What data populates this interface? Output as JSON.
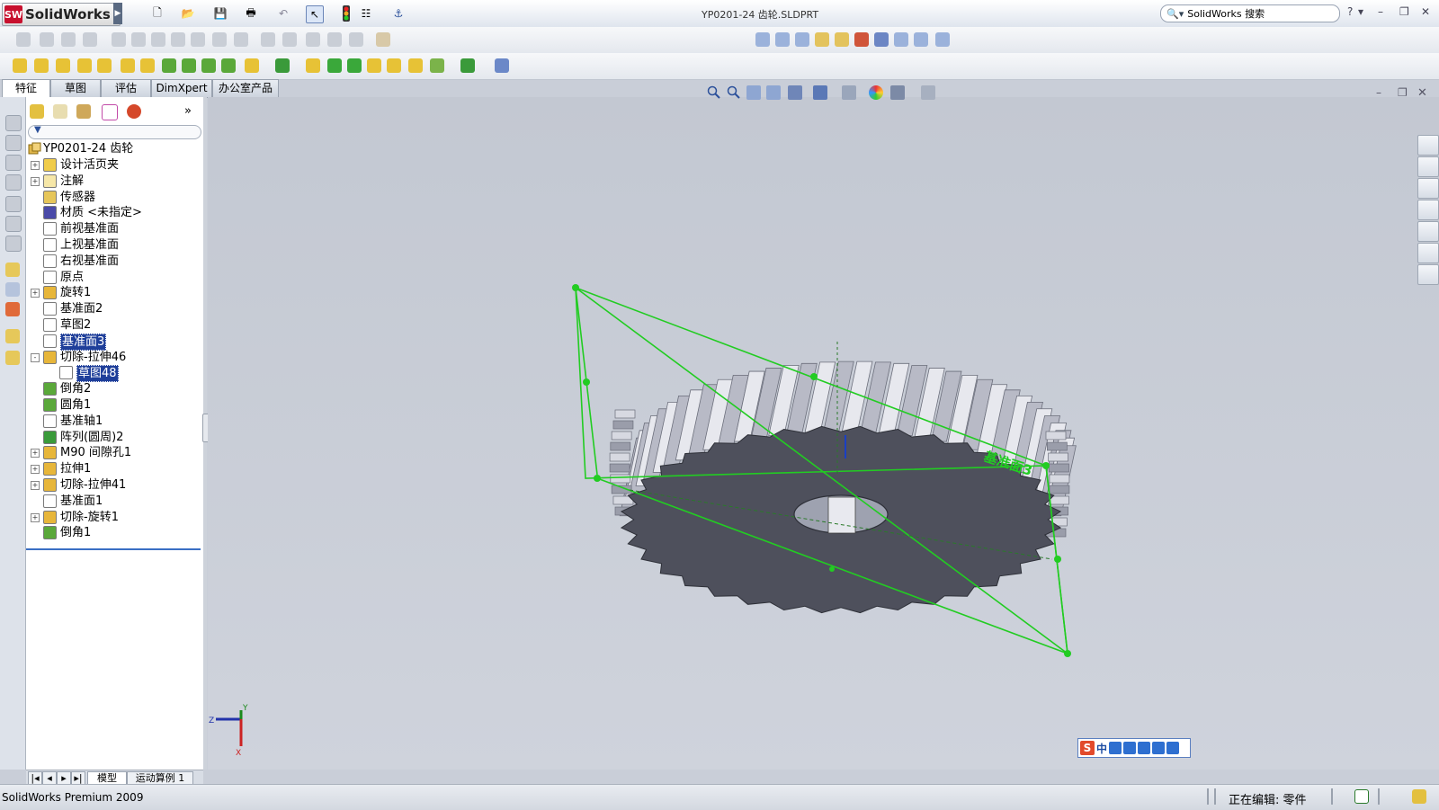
{
  "app": {
    "logo_text": "SolidWorks",
    "document_title": "YP0201-24 齿轮.SLDPRT",
    "search_placeholder": "SolidWorks 搜索",
    "help_label": "?"
  },
  "command_tabs": [
    "特征",
    "草图",
    "评估",
    "DimXpert",
    "办公室产品"
  ],
  "feature_tree": {
    "root": "YP0201-24 齿轮",
    "items": [
      {
        "label": "设计活页夹",
        "expand": "+",
        "icon": "binder-icon"
      },
      {
        "label": "注解",
        "expand": "+",
        "icon": "annotation-icon"
      },
      {
        "label": "传感器",
        "expand": "",
        "icon": "sensor-icon"
      },
      {
        "label": "材质 <未指定>",
        "expand": "",
        "icon": "material-icon"
      },
      {
        "label": "前视基准面",
        "expand": "",
        "icon": "plane-icon"
      },
      {
        "label": "上视基准面",
        "expand": "",
        "icon": "plane-icon"
      },
      {
        "label": "右视基准面",
        "expand": "",
        "icon": "plane-icon"
      },
      {
        "label": "原点",
        "expand": "",
        "icon": "origin-icon"
      },
      {
        "label": "旋转1",
        "expand": "+",
        "icon": "revolve-icon"
      },
      {
        "label": "基准面2",
        "expand": "",
        "icon": "plane-icon"
      },
      {
        "label": "草图2",
        "expand": "",
        "icon": "sketch-icon"
      },
      {
        "label": "基准面3",
        "expand": "",
        "icon": "plane-icon",
        "selected": true
      },
      {
        "label": "切除-拉伸46",
        "expand": "-",
        "icon": "cut-extrude-icon"
      },
      {
        "label": "草图48",
        "expand": "",
        "icon": "sketch-icon",
        "selected": true,
        "child": true
      },
      {
        "label": "倒角2",
        "expand": "",
        "icon": "chamfer-icon"
      },
      {
        "label": "圆角1",
        "expand": "",
        "icon": "fillet-icon"
      },
      {
        "label": "基准轴1",
        "expand": "",
        "icon": "axis-icon"
      },
      {
        "label": "阵列(圆周)2",
        "expand": "",
        "icon": "circular-pattern-icon"
      },
      {
        "label": "M90 间隙孔1",
        "expand": "+",
        "icon": "hole-icon"
      },
      {
        "label": "拉伸1",
        "expand": "+",
        "icon": "extrude-icon"
      },
      {
        "label": "切除-拉伸41",
        "expand": "+",
        "icon": "cut-extrude-icon"
      },
      {
        "label": "基准面1",
        "expand": "",
        "icon": "plane-icon"
      },
      {
        "label": "切除-旋转1",
        "expand": "+",
        "icon": "cut-revolve-icon"
      },
      {
        "label": "倒角1",
        "expand": "",
        "icon": "chamfer-icon"
      }
    ]
  },
  "graphics": {
    "plane_label": "基准面3",
    "triad": {
      "x": "X",
      "y": "Y",
      "z": "Z"
    }
  },
  "bottom_tabs": [
    "模型",
    "运动算例 1"
  ],
  "status": {
    "product": "SolidWorks Premium 2009",
    "editing": "正在编辑: 零件"
  },
  "ime": {
    "brand": "S",
    "mode": "中"
  },
  "colors": {
    "accent": "#1f3f9a",
    "sketch_green": "#22cc22",
    "gear_face": "#4e505c"
  }
}
